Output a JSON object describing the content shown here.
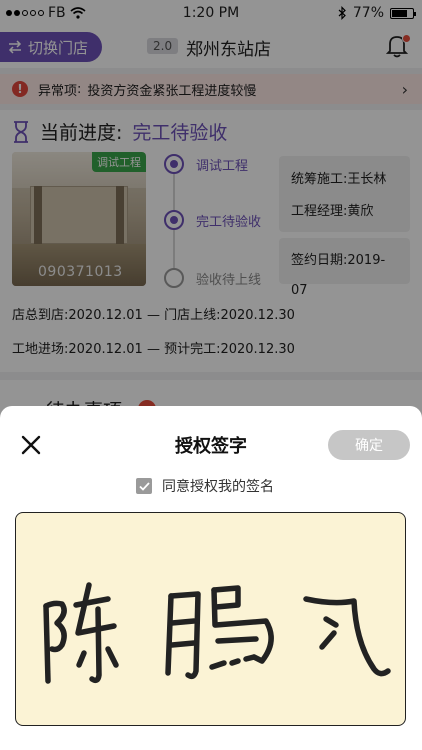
{
  "statusbar": {
    "carrier": "FB",
    "time": "1:20 PM",
    "battery": "77%"
  },
  "header": {
    "switch_label": "切换门店",
    "version": "2.0",
    "store_name": "郑州东站店"
  },
  "alert": {
    "label": "异常项",
    "colon": ":",
    "message": "投资方资金紧张工程进度较慢"
  },
  "progress": {
    "label": "当前进度:",
    "stage": "完工待验收",
    "thumb_badge": "调试工程",
    "thumb_code": "090371013",
    "steps": [
      {
        "label": "调试工程",
        "active": true
      },
      {
        "label": "完工待验收",
        "active": true
      },
      {
        "label": "验收待上线",
        "active": false
      }
    ],
    "info": {
      "construction": "统筹施工:王长林",
      "manager": "工程经理:黄欣",
      "sign_date": "签约日期:2019-07"
    },
    "dates": {
      "line1": "店总到店:2020.12.01 — 门店上线:2020.12.30",
      "line2": "工地进场:2020.12.01 — 预计完工:2020.12.30"
    }
  },
  "todo": {
    "title": "待办事项"
  },
  "sheet": {
    "title": "授权签字",
    "confirm": "确定",
    "agree_label": "同意授权我的签名",
    "agree_checked": true,
    "signature_text": "陈鹏飞"
  },
  "colors": {
    "accent": "#6d51b8",
    "alert_red": "#e2483d",
    "pad_bg": "#fbf3d5"
  }
}
